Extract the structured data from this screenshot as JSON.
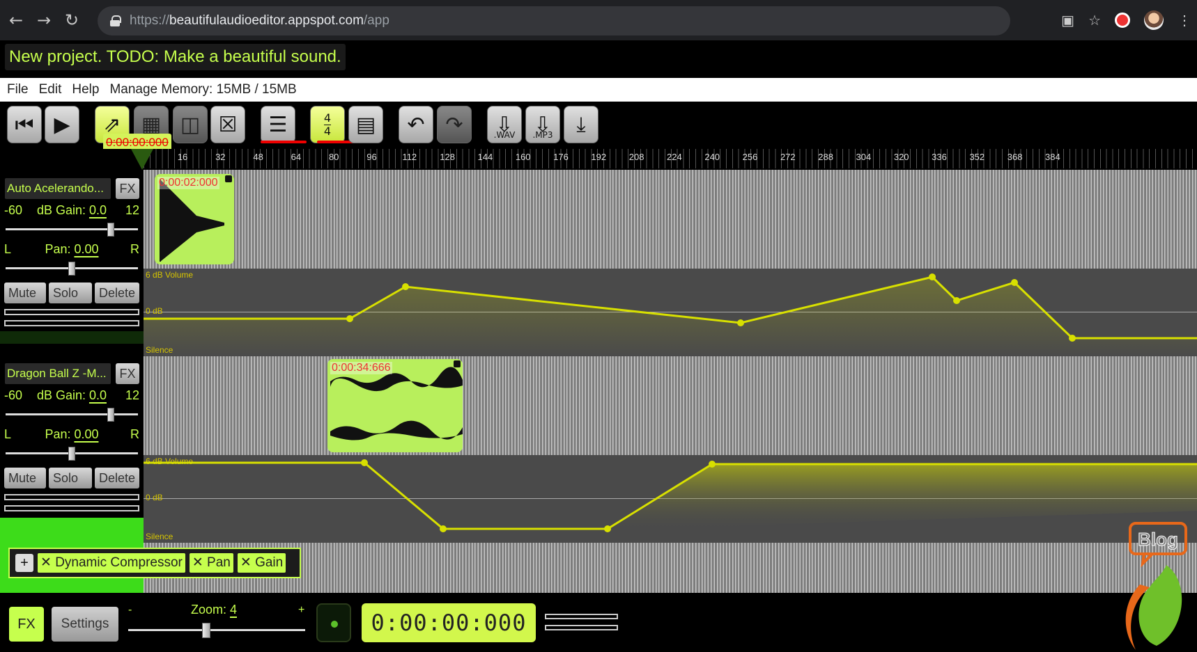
{
  "browser": {
    "url_scheme": "https://",
    "url_host": "beautifulaudioeditor.appspot.com",
    "url_path": "/app"
  },
  "project": {
    "title": "New project. TODO: Make a beautiful sound."
  },
  "menu": {
    "file": "File",
    "edit": "Edit",
    "help": "Help",
    "memory": "Manage Memory: 15MB / 15MB"
  },
  "toolbar": {
    "wav_label": ".WAV",
    "mp3_label": ".MP3",
    "time_sig_top": "4",
    "time_sig_bottom": "4",
    "playhead_time": "0:00:00:000"
  },
  "ruler_ticks": [
    "16",
    "32",
    "48",
    "64",
    "80",
    "96",
    "112",
    "128",
    "144",
    "160",
    "176",
    "192",
    "208",
    "224",
    "240",
    "256",
    "272",
    "288",
    "304",
    "320",
    "336",
    "352",
    "368",
    "384"
  ],
  "tracks": [
    {
      "name": "Auto Acelerando...",
      "fx_label": "FX",
      "gain_min": "-60",
      "gain_text": "dB Gain:",
      "gain_value": "0.0",
      "gain_max": "12",
      "pan_left": "L",
      "pan_text": "Pan:",
      "pan_value": "0.00",
      "pan_right": "R",
      "mute": "Mute",
      "solo": "Solo",
      "delete": "Delete",
      "clip_time": "0:00:02:000",
      "auto_top": "6 dB Volume",
      "auto_zero": "0 dB",
      "auto_bottom": "Silence"
    },
    {
      "name": "Dragon Ball Z -M...",
      "fx_label": "FX",
      "gain_min": "-60",
      "gain_text": "dB Gain:",
      "gain_value": "0.0",
      "gain_max": "12",
      "pan_left": "L",
      "pan_text": "Pan:",
      "pan_value": "0.00",
      "pan_right": "R",
      "mute": "Mute",
      "solo": "Solo",
      "delete": "Delete",
      "clip_time": "0:00:34:666",
      "auto_top": "6 dB Volume",
      "auto_zero": "0 dB",
      "auto_bottom": "Silence"
    }
  ],
  "fx_chain": {
    "add": "+",
    "items": [
      "✕ Dynamic Compressor",
      "✕ Pan",
      "✕ Gain"
    ]
  },
  "bottom": {
    "fx": "FX",
    "settings": "Settings",
    "zoom_label": "Zoom:",
    "zoom_value": "4",
    "zoom_minus": "-",
    "zoom_plus": "+",
    "clock": "0:00:00:000"
  },
  "logo": {
    "text": "Blog"
  },
  "colors": {
    "accent": "#c6ff4d",
    "clip": "#b8ef5c",
    "automation": "#d8e000",
    "background": "#000000"
  }
}
